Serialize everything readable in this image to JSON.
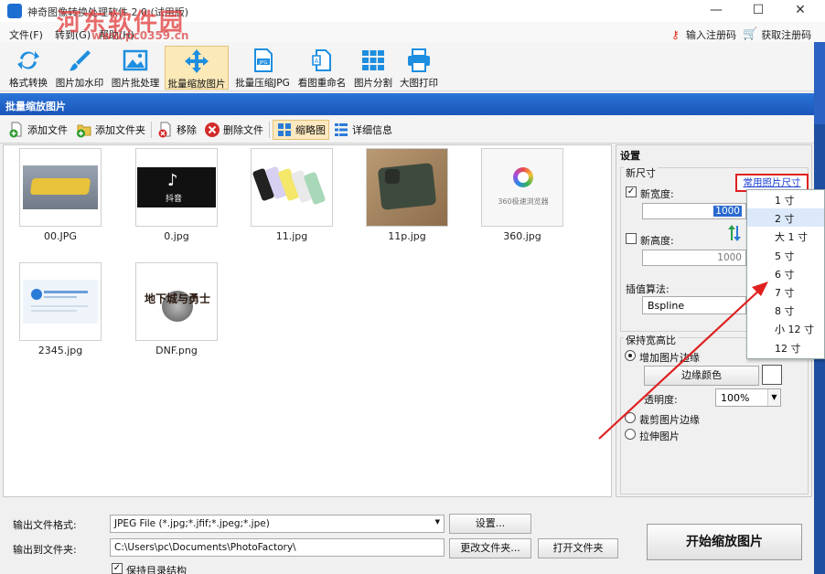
{
  "window": {
    "title": "神奇图像转换处理软件 2.0 (试用版)",
    "min": "—",
    "max": "☐",
    "close": "✕"
  },
  "watermark": {
    "name": "河东软件园",
    "url": "www.pc0359.cn"
  },
  "menu": {
    "items": [
      "文件(F)",
      "转到(G)",
      "帮助(H)"
    ],
    "register": "输入注册码",
    "get_code": "获取注册码"
  },
  "toolbar": {
    "items": [
      "格式转换",
      "图片加水印",
      "图片批处理",
      "批量缩放图片",
      "批量压缩JPG",
      "看图重命名",
      "图片分割",
      "大图打印"
    ],
    "active_index": 3
  },
  "section": {
    "title": "批量缩放图片"
  },
  "subbar": {
    "add_file": "添加文件",
    "add_folder": "添加文件夹",
    "remove": "移除",
    "delete_file": "删除文件",
    "thumbnail": "缩略图",
    "details": "详细信息"
  },
  "files": [
    {
      "name": "00.JPG"
    },
    {
      "name": "0.jpg"
    },
    {
      "name": "11.jpg"
    },
    {
      "name": "11p.jpg"
    },
    {
      "name": "360.jpg"
    },
    {
      "name": "2345.jpg"
    },
    {
      "name": "DNF.png"
    }
  ],
  "thumb_text": {
    "douyin": "抖音",
    "browser360": "360极速浏览器",
    "dnf_logo": "地下城与勇士"
  },
  "settings": {
    "title": "设置",
    "new_size": "新尺寸",
    "common_sizes_link": "常用照片尺寸",
    "new_width_label": "新宽度:",
    "new_width_checked": true,
    "new_width_value": "1000",
    "new_height_label": "新高度:",
    "new_height_checked": false,
    "new_height_value": "1000",
    "interp_label": "插值算法:",
    "interp_value": "Bspline",
    "keep_ratio": "保持宽高比",
    "opt_add_border": "增加图片边缘",
    "border_color_btn": "边缘颜色",
    "opacity_label": "透明度:",
    "opacity_value": "100%",
    "opt_crop": "裁剪图片边缘",
    "opt_stretch": "拉伸图片"
  },
  "size_dropdown": {
    "items": [
      "1 寸",
      "2 寸",
      "大 1 寸",
      "5 寸",
      "6 寸",
      "7 寸",
      "8 寸",
      "小 12 寸",
      "12 寸"
    ],
    "selected_index": 1
  },
  "bottom": {
    "format_label": "输出文件格式:",
    "format_value": "JPEG File (*.jpg;*.jfif;*.jpeg;*.jpe)",
    "settings_btn": "设置...",
    "folder_label": "输出到文件夹:",
    "folder_value": "C:\\Users\\pc\\Documents\\PhotoFactory\\",
    "change_folder_btn": "更改文件夹...",
    "open_folder_btn": "打开文件夹",
    "keep_structure": "保持目录结构",
    "keep_structure_checked": true,
    "start_btn": "开始缩放图片"
  },
  "colors": {
    "accent": "#1a55b8",
    "highlight": "#e02020",
    "link": "#1a3fd0"
  }
}
